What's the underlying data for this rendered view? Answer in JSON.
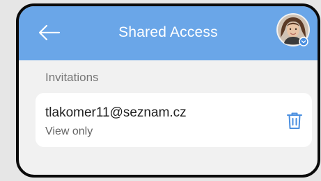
{
  "header": {
    "title": "Shared Access",
    "back_icon": "arrow-left-icon",
    "avatar_icon": "user-avatar",
    "background_color": "#6aa6e8"
  },
  "invitations": {
    "section_label": "Invitations",
    "items": [
      {
        "email": "tlakomer11@seznam.cz",
        "permission": "View only",
        "action_icon": "trash-icon",
        "action_color": "#4a8fe0"
      }
    ]
  }
}
